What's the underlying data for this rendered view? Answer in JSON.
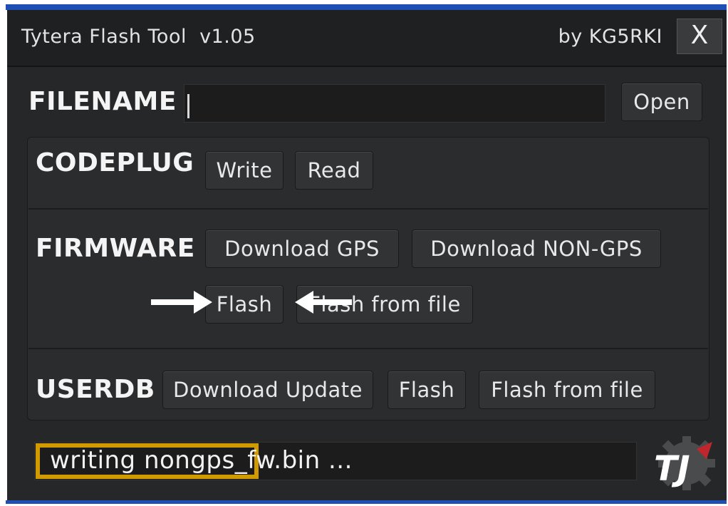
{
  "window": {
    "title": "Tytera Flash Tool  v1.05",
    "author": "by KG5RKI",
    "close_label": "X"
  },
  "filename": {
    "label": "FILENAME",
    "value": "",
    "open_label": "Open"
  },
  "codeplug": {
    "label": "CODEPLUG",
    "write_label": "Write",
    "read_label": "Read"
  },
  "firmware": {
    "label": "FIRMWARE",
    "download_gps_label": "Download GPS",
    "download_nongps_label": "Download NON-GPS",
    "flash_label": "Flash",
    "flash_from_file_label": "Flash from file"
  },
  "userdb": {
    "label": "USERDB",
    "download_update_label": "Download Update",
    "flash_label": "Flash",
    "flash_from_file_label": "Flash from file"
  },
  "status": {
    "text": "writing nongps_fw.bin ...",
    "progress_fraction": 0.37
  },
  "icons": {
    "annotation_arrow_right": "arrow-right-icon",
    "annotation_arrow_left": "arrow-left-icon",
    "logo": "tj-gear-logo"
  },
  "colors": {
    "window_bg": "#262728",
    "progress": "#d19a00",
    "frame_border": "#1f4fb5"
  }
}
